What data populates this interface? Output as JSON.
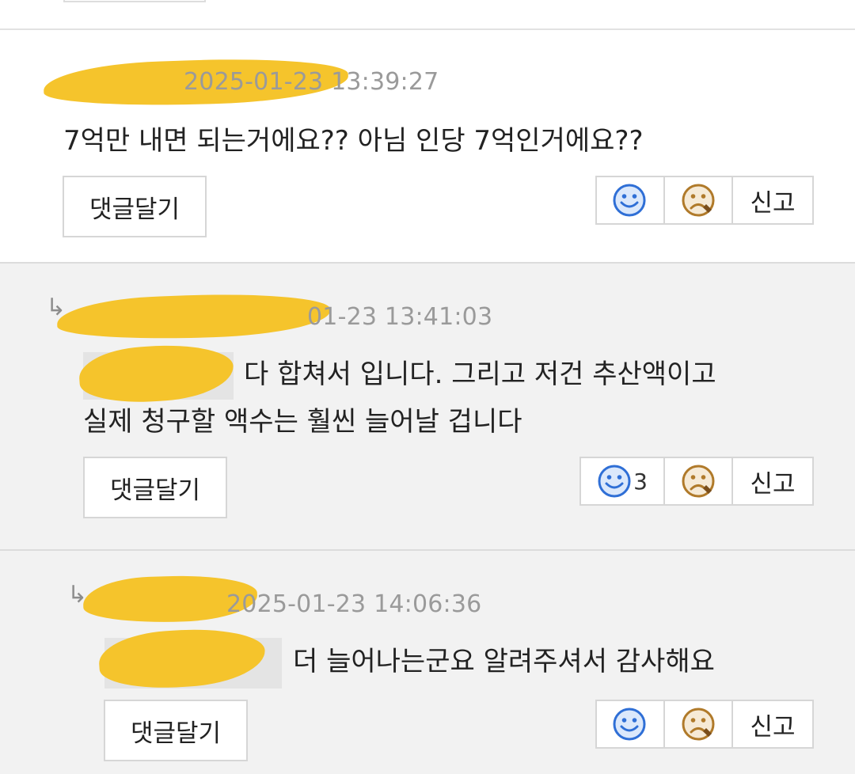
{
  "colors": {
    "redaction": "#f5c42c",
    "smile": "#2f6fd6",
    "frown": "#b07a2a",
    "text": "#222222",
    "meta": "#9a9a9a"
  },
  "comments": [
    {
      "timestamp": "2025-01-23 13:39:27",
      "body": "7억만 내면 되는거에요?? 아님 인당 7억인거에요??",
      "reply_button": "댓글달기",
      "like_count": "",
      "report_label": "신고",
      "icons": {
        "like": "smile-icon",
        "dislike": "frown-icon"
      }
    },
    {
      "reply_marker": "↳",
      "timestamp": "01-23 13:41:03",
      "body_line1": "다 합쳐서 입니다. 그리고 저건 추산액이고",
      "body_line2": "실제 청구할 액수는 훨씬 늘어날 겁니다",
      "reply_button": "댓글달기",
      "like_count": "3",
      "report_label": "신고",
      "icons": {
        "like": "smile-icon",
        "dislike": "frown-icon"
      }
    },
    {
      "reply_marker": "↳",
      "timestamp": "2025-01-23 14:06:36",
      "body": "더 늘어나는군요 알려주셔서 감사해요",
      "reply_button": "댓글달기",
      "like_count": "",
      "report_label": "신고",
      "icons": {
        "like": "smile-icon",
        "dislike": "frown-icon"
      }
    }
  ]
}
